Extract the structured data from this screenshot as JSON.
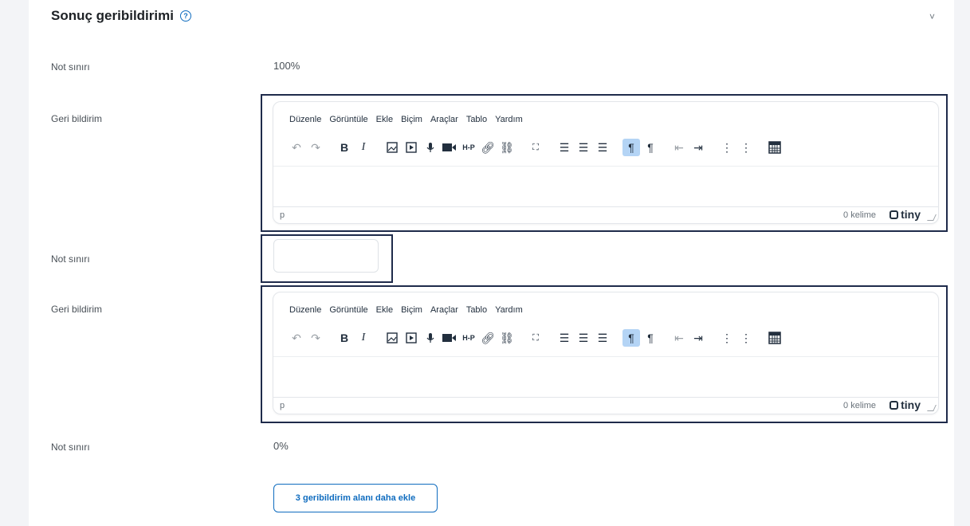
{
  "section": {
    "title": "Sonuç geribildirimi",
    "help_icon": "?",
    "collapse_icon": "˅"
  },
  "rows": {
    "grade1": {
      "label": "Not sınırı",
      "value": "100%"
    },
    "feedback1": {
      "label": "Geri bildirim"
    },
    "grade2": {
      "label": "Not sınırı",
      "value": ""
    },
    "feedback2": {
      "label": "Geri bildirim"
    },
    "grade3": {
      "label": "Not sınırı",
      "value": "0%"
    }
  },
  "editor": {
    "menu": [
      "Düzenle",
      "Görüntüle",
      "Ekle",
      "Biçim",
      "Araçlar",
      "Tablo",
      "Yardım"
    ],
    "toolbar_icons": [
      "undo-icon",
      "redo-icon",
      "bold-icon",
      "italic-icon",
      "image-icon",
      "media-icon",
      "record-audio-icon",
      "record-video-icon",
      "h5p-icon",
      "link-icon",
      "unlink-icon",
      "fullscreen-icon",
      "align-left-icon",
      "align-center-icon",
      "align-right-icon",
      "ltr-icon",
      "rtl-icon",
      "outdent-icon",
      "indent-icon",
      "bullet-list-icon",
      "numbered-list-icon",
      "calculator-icon"
    ],
    "path": "p",
    "word_count": "0 kelime",
    "brand": "tiny"
  },
  "actions": {
    "add_fields": "3 geribildirim alanı daha ekle"
  }
}
